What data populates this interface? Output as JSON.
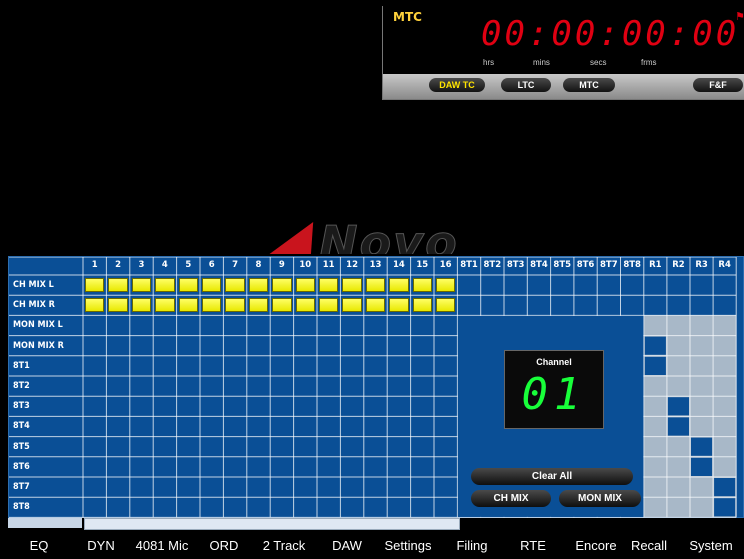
{
  "timecode": {
    "label": "MTC",
    "time": "00:00:00:00",
    "units": [
      "hrs",
      "mins",
      "secs",
      "frms"
    ],
    "sources": [
      {
        "label": "DAW TC",
        "active": true
      },
      {
        "label": "LTC",
        "active": false
      },
      {
        "label": "MTC",
        "active": false
      },
      {
        "label": "F&F",
        "active": false
      }
    ],
    "colors": {
      "digits": "#e00012",
      "label": "#ffd23c",
      "active_source": "#ffe400"
    }
  },
  "logo": {
    "text": "Novo"
  },
  "routing": {
    "channel_columns": [
      "1",
      "2",
      "3",
      "4",
      "5",
      "6",
      "7",
      "8",
      "9",
      "10",
      "11",
      "12",
      "13",
      "14",
      "15",
      "16"
    ],
    "bus_columns": [
      "8T1",
      "8T2",
      "8T3",
      "8T4",
      "8T5",
      "8T6",
      "8T7",
      "8T8"
    ],
    "return_columns": [
      "R1",
      "R2",
      "R3",
      "R4"
    ],
    "rows": [
      "CH MIX L",
      "CH MIX R",
      "MON MIX L",
      "MON MIX R",
      "8T1",
      "8T2",
      "8T3",
      "8T4",
      "8T5",
      "8T6",
      "8T7",
      "8T8"
    ],
    "active_rows": [
      "CH MIX L",
      "CH MIX R"
    ],
    "return_selected": [
      [
        4,
        0
      ],
      [
        5,
        0
      ],
      [
        7,
        1
      ],
      [
        8,
        1
      ],
      [
        9,
        2
      ],
      [
        10,
        2
      ],
      [
        11,
        3
      ],
      [
        12,
        3
      ]
    ],
    "channel": {
      "label": "Channel",
      "number": "01"
    },
    "buttons": {
      "clear_all": "Clear All",
      "ch_mix": "CH MIX",
      "mon_mix": "MON MIX"
    },
    "colors": {
      "panel": "#0a4f96",
      "selected": "#ffff33",
      "channel_digits": "#18ff3a"
    }
  },
  "tabs": [
    "EQ",
    "DYN",
    "4081 Mic",
    "ORD",
    "2 Track",
    "DAW",
    "Settings",
    "Filing",
    "RTE",
    "Encore",
    "Recall",
    "System"
  ]
}
